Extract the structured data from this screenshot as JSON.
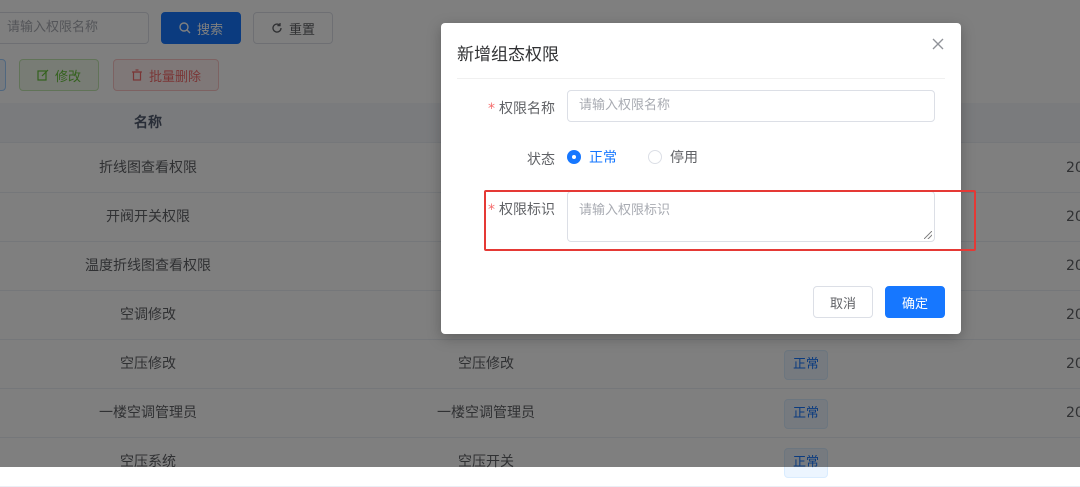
{
  "toolbar": {
    "search_placeholder": "请输入权限名称",
    "search_label": "搜索",
    "reset_label": "重置",
    "edit_label": "修改",
    "batch_delete_label": "批量删除"
  },
  "table": {
    "header_name": "名称",
    "rows": [
      {
        "name": "折线图查看权限",
        "key": "",
        "status": "",
        "date": "20"
      },
      {
        "name": "开阀开关权限",
        "key": "",
        "status": "",
        "date": "20"
      },
      {
        "name": "温度折线图查看权限",
        "key": "",
        "status": "",
        "date": "20"
      },
      {
        "name": "空调修改",
        "key": "",
        "status": "",
        "date": "20"
      },
      {
        "name": "空压修改",
        "key": "空压修改",
        "status": "正常",
        "date": "20"
      },
      {
        "name": "一楼空调管理员",
        "key": "一楼空调管理员",
        "status": "正常",
        "date": "20"
      },
      {
        "name": "空压系统",
        "key": "空压开关",
        "status": "正常",
        "date": ""
      }
    ]
  },
  "dialog": {
    "title": "新增组态权限",
    "name_label": "权限名称",
    "name_placeholder": "请输入权限名称",
    "status_label": "状态",
    "status_options": [
      "正常",
      "停用"
    ],
    "key_label": "权限标识",
    "key_placeholder": "请输入权限标识",
    "cancel_label": "取消",
    "confirm_label": "确定",
    "required_mark": "*"
  },
  "colors": {
    "primary": "#1677ff",
    "success": "#67c23a",
    "danger": "#f56c6c",
    "highlight": "#e53935"
  },
  "icons": [
    "search-icon",
    "refresh-icon",
    "edit-icon",
    "delete-icon",
    "close-icon"
  ]
}
